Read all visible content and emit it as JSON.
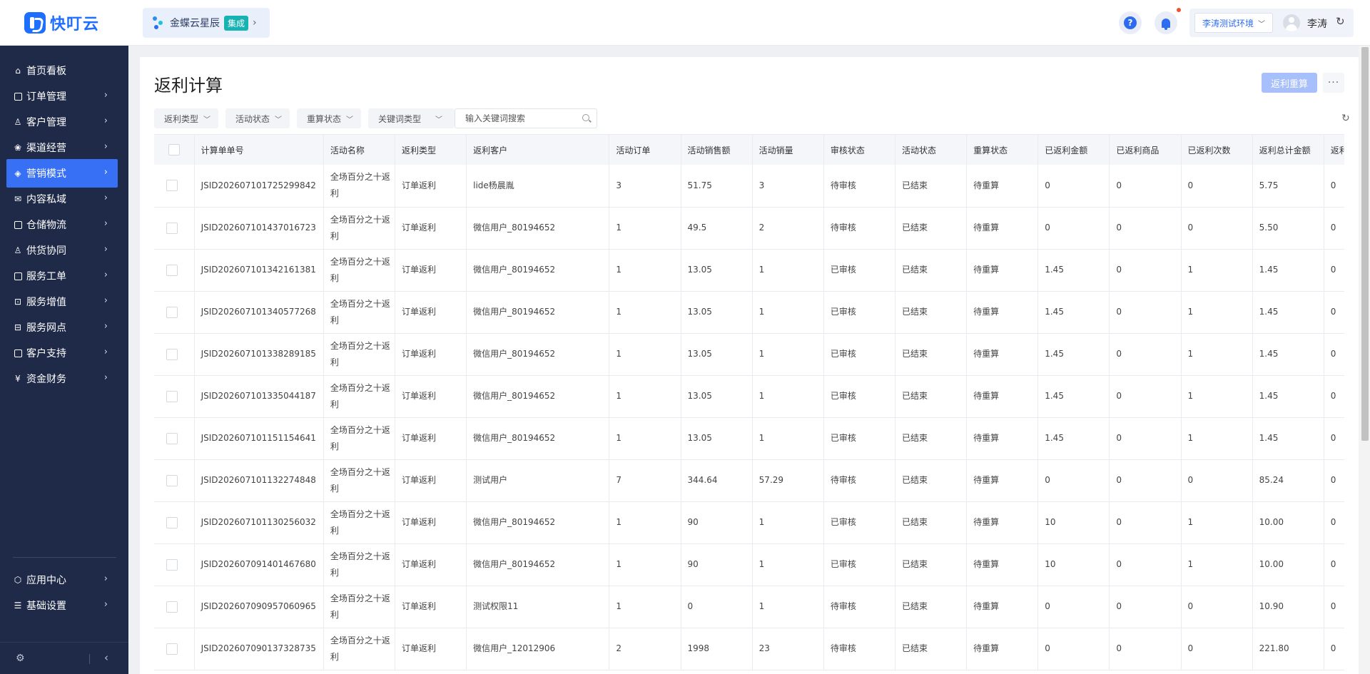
{
  "header": {
    "logo_text": "快叮云",
    "kingdee_name": "金蝶云星辰",
    "kingdee_badge": "集成",
    "env_label": "李涛测试环境",
    "username": "李涛"
  },
  "sidebar": {
    "items": [
      {
        "label": "首页看板",
        "icon": "home-icon",
        "chevron": false,
        "active": false
      },
      {
        "label": "订单管理",
        "icon": "order-icon",
        "chevron": true,
        "active": false
      },
      {
        "label": "客户管理",
        "icon": "customer-icon",
        "chevron": true,
        "active": false
      },
      {
        "label": "渠道经营",
        "icon": "channel-icon",
        "chevron": true,
        "active": false
      },
      {
        "label": "营销模式",
        "icon": "marketing-icon",
        "chevron": true,
        "active": true
      },
      {
        "label": "内容私域",
        "icon": "content-icon",
        "chevron": true,
        "active": false
      },
      {
        "label": "仓储物流",
        "icon": "warehouse-icon",
        "chevron": true,
        "active": false
      },
      {
        "label": "供货协同",
        "icon": "supply-icon",
        "chevron": true,
        "active": false
      },
      {
        "label": "服务工单",
        "icon": "ticket-icon",
        "chevron": true,
        "active": false
      },
      {
        "label": "服务增值",
        "icon": "value-added-icon",
        "chevron": true,
        "active": false
      },
      {
        "label": "服务网点",
        "icon": "outlet-icon",
        "chevron": true,
        "active": false
      },
      {
        "label": "客户支持",
        "icon": "support-icon",
        "chevron": true,
        "active": false
      },
      {
        "label": "资金财务",
        "icon": "finance-icon",
        "chevron": true,
        "active": false
      }
    ],
    "bottom_items": [
      {
        "label": "应用中心",
        "icon": "app-center-icon"
      },
      {
        "label": "基础设置",
        "icon": "settings-list-icon"
      }
    ]
  },
  "page": {
    "title": "返利计算",
    "recalc_button": "返利重算",
    "more_button": "···"
  },
  "filters": {
    "items": [
      "返利类型",
      "活动状态",
      "重算状态",
      "关键词类型"
    ],
    "search_placeholder": "输入关键词搜索"
  },
  "table": {
    "columns": [
      "计算单单号",
      "活动名称",
      "返利类型",
      "返利客户",
      "活动订单",
      "活动销售额",
      "活动销量",
      "审核状态",
      "活动状态",
      "重算状态",
      "已返利金额",
      "已返利商品",
      "已返利次数",
      "返利总计金额",
      "返利"
    ],
    "rows": [
      [
        "JSID202607101725299842",
        "全场百分之十返利",
        "订单返利",
        "lide杨晨胤",
        "3",
        "51.75",
        "3",
        "待审核",
        "已结束",
        "待重算",
        "0",
        "0",
        "0",
        "5.75",
        "0"
      ],
      [
        "JSID202607101437016723",
        "全场百分之十返利",
        "订单返利",
        "微信用户_80194652",
        "1",
        "49.5",
        "2",
        "待审核",
        "已结束",
        "待重算",
        "0",
        "0",
        "0",
        "5.50",
        "0"
      ],
      [
        "JSID202607101342161381",
        "全场百分之十返利",
        "订单返利",
        "微信用户_80194652",
        "1",
        "13.05",
        "1",
        "已审核",
        "已结束",
        "待重算",
        "1.45",
        "0",
        "1",
        "1.45",
        "0"
      ],
      [
        "JSID202607101340577268",
        "全场百分之十返利",
        "订单返利",
        "微信用户_80194652",
        "1",
        "13.05",
        "1",
        "已审核",
        "已结束",
        "待重算",
        "1.45",
        "0",
        "1",
        "1.45",
        "0"
      ],
      [
        "JSID202607101338289185",
        "全场百分之十返利",
        "订单返利",
        "微信用户_80194652",
        "1",
        "13.05",
        "1",
        "已审核",
        "已结束",
        "待重算",
        "1.45",
        "0",
        "1",
        "1.45",
        "0"
      ],
      [
        "JSID202607101335044187",
        "全场百分之十返利",
        "订单返利",
        "微信用户_80194652",
        "1",
        "13.05",
        "1",
        "已审核",
        "已结束",
        "待重算",
        "1.45",
        "0",
        "1",
        "1.45",
        "0"
      ],
      [
        "JSID202607101151154641",
        "全场百分之十返利",
        "订单返利",
        "微信用户_80194652",
        "1",
        "13.05",
        "1",
        "已审核",
        "已结束",
        "待重算",
        "1.45",
        "0",
        "1",
        "1.45",
        "0"
      ],
      [
        "JSID202607101132274848",
        "全场百分之十返利",
        "订单返利",
        "测试用户",
        "7",
        "344.64",
        "57.29",
        "待审核",
        "已结束",
        "待重算",
        "0",
        "0",
        "0",
        "85.24",
        "0"
      ],
      [
        "JSID202607101130256032",
        "全场百分之十返利",
        "订单返利",
        "微信用户_80194652",
        "1",
        "90",
        "1",
        "已审核",
        "已结束",
        "待重算",
        "10",
        "0",
        "1",
        "10.00",
        "0"
      ],
      [
        "JSID202607091401467680",
        "全场百分之十返利",
        "订单返利",
        "微信用户_80194652",
        "1",
        "90",
        "1",
        "已审核",
        "已结束",
        "待重算",
        "10",
        "0",
        "1",
        "10.00",
        "0"
      ],
      [
        "JSID202607090957060965",
        "全场百分之十返利",
        "订单返利",
        "测试权限11",
        "1",
        "0",
        "1",
        "待审核",
        "已结束",
        "待重算",
        "0",
        "0",
        "0",
        "10.90",
        "0"
      ],
      [
        "JSID202607090137328735",
        "全场百分之十返利",
        "订单返利",
        "微信用户_12012906",
        "2",
        "1998",
        "23",
        "待审核",
        "已结束",
        "待重算",
        "0",
        "0",
        "0",
        "221.80",
        "0"
      ]
    ]
  },
  "colors": {
    "sidebar_bg": "#1e2a47",
    "accent": "#3870f5",
    "recalc_button_disabled": "#a7bffa"
  }
}
